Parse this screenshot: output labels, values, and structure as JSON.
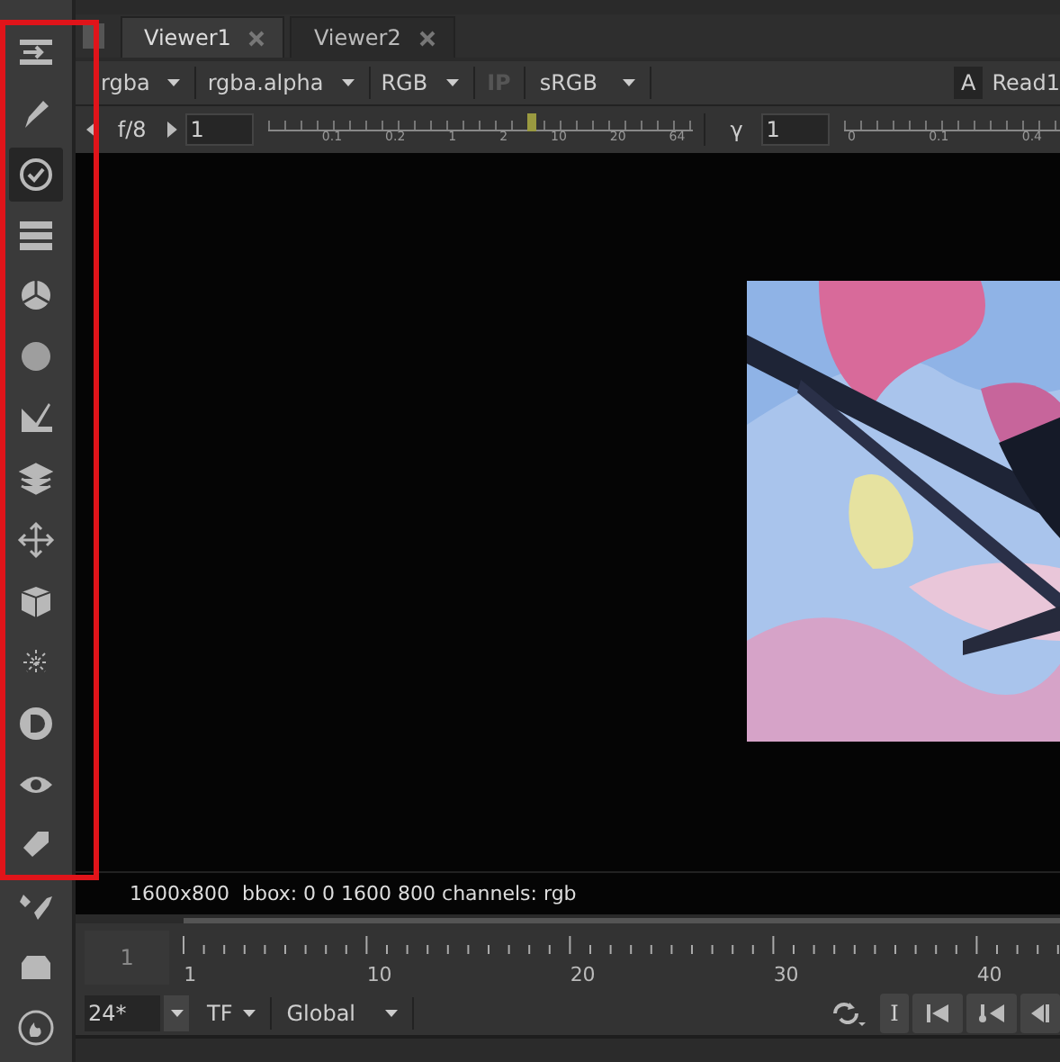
{
  "sidebar": {
    "annotation_frame": true,
    "tools": [
      {
        "selected": false
      },
      {
        "selected": false
      },
      {
        "selected": true
      },
      {
        "selected": false
      },
      {
        "selected": false
      },
      {
        "selected": false
      },
      {
        "selected": false
      },
      {
        "selected": false
      },
      {
        "selected": false
      },
      {
        "selected": false
      },
      {
        "selected": false
      },
      {
        "selected": false
      },
      {
        "selected": false
      },
      {
        "selected": false
      },
      {
        "selected": false
      },
      {
        "selected": false
      },
      {
        "selected": false
      }
    ]
  },
  "tabs": [
    {
      "label": "Viewer1",
      "selected": true
    },
    {
      "label": "Viewer2",
      "selected": false
    }
  ],
  "viewer_controls": {
    "dropdowns": [
      {
        "value": "rgba"
      },
      {
        "value": "rgba.alpha"
      },
      {
        "value": "RGB"
      }
    ],
    "ip_button": {
      "label": "IP",
      "disabled": true
    },
    "lut": {
      "value": "sRGB"
    },
    "input_a": "A",
    "input_name": "Read1"
  },
  "exposure": {
    "label": "f/8",
    "value": "1",
    "level": 0.62,
    "ticks": [
      "0.1",
      "0.2",
      "1",
      "2",
      "10",
      "20",
      "64"
    ]
  },
  "gamma": {
    "label": "γ",
    "value": "1",
    "ticks": [
      "0",
      "0.1",
      "0.4"
    ]
  },
  "viewer": {
    "info": "1600x800  bbox: 0 0 1600 800 channels: rgb"
  },
  "timeline": {
    "frame": "1",
    "labels": [
      "1",
      "10",
      "20",
      "30",
      "40"
    ]
  },
  "playback": {
    "fps": "24*",
    "timecode": "TF",
    "range": "Global",
    "in_button": "I"
  }
}
